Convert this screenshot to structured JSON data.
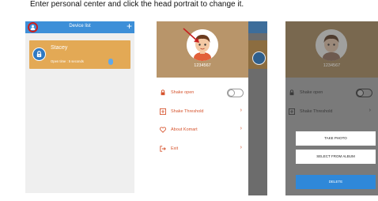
{
  "instruction": "Enter personal center and click the head portrait to change it.",
  "panel1": {
    "header_title": "Device list",
    "add_icon": "plus",
    "device": {
      "name": "Stacey",
      "status": "Open time : 5 seconds"
    }
  },
  "panel2": {
    "user_id": "1234567",
    "menu": [
      {
        "label": "Shake open",
        "icon": "shake-lock-icon",
        "control": "toggle"
      },
      {
        "label": "Shake Threshold",
        "icon": "threshold-icon",
        "control": "arrow"
      },
      {
        "label": "About Komart",
        "icon": "heart-icon",
        "control": "arrow"
      },
      {
        "label": "Exit",
        "icon": "exit-icon",
        "control": "arrow"
      }
    ]
  },
  "panel3": {
    "user_id": "1234567",
    "menu": [
      {
        "label": "Shake open"
      },
      {
        "label": "Shake Threshold"
      }
    ],
    "sheet": {
      "take_photo": "TAKE PHOTO",
      "select_album": "SELECT FROM ALBUM",
      "delete": "DELETE"
    }
  },
  "colors": {
    "accent_blue": "#3d8fd8",
    "card_orange": "#e3a955",
    "drawer_tan": "#b8956a",
    "menu_red": "#d6542e",
    "highlight_red": "#c81f1f"
  }
}
